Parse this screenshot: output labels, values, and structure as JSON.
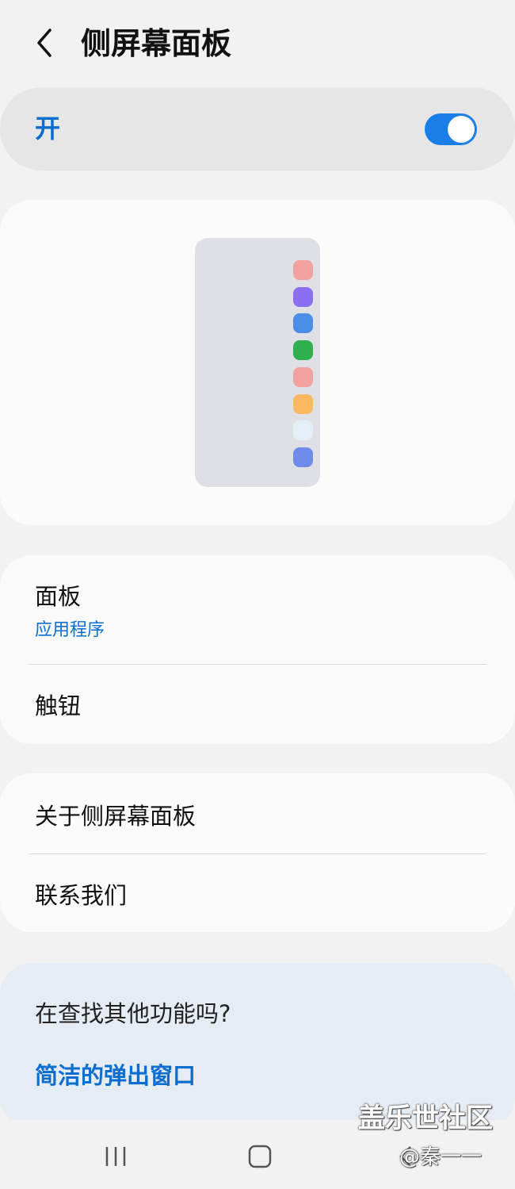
{
  "header": {
    "back_icon": "chevron-left-icon",
    "title": "侧屏幕面板"
  },
  "master_switch": {
    "label": "开",
    "state": "on",
    "accent_color": "#1a7ee8"
  },
  "preview": {
    "panel_color": "#dfe0e5",
    "app_colors": [
      "#f2a0a0",
      "#8c6ff0",
      "#4a8ee8",
      "#2fb04e",
      "#f2a0a0",
      "#fbb861",
      "#e4f0f8",
      "#6f8bea"
    ]
  },
  "settings_group_1": {
    "panels": {
      "title": "面板",
      "subtitle": "应用程序"
    },
    "handle": {
      "title": "触钮"
    }
  },
  "settings_group_2": {
    "about": {
      "title": "关于侧屏幕面板"
    },
    "contact": {
      "title": "联系我们"
    }
  },
  "suggestion": {
    "question": "在查找其他功能吗?",
    "link": "简洁的弹出窗口"
  },
  "nav_bar": {
    "recents_icon": "recents-icon",
    "home_icon": "home-icon",
    "back_icon": "back-icon"
  },
  "watermark": {
    "brand": "盖乐世社区",
    "author": "@秦一一"
  }
}
